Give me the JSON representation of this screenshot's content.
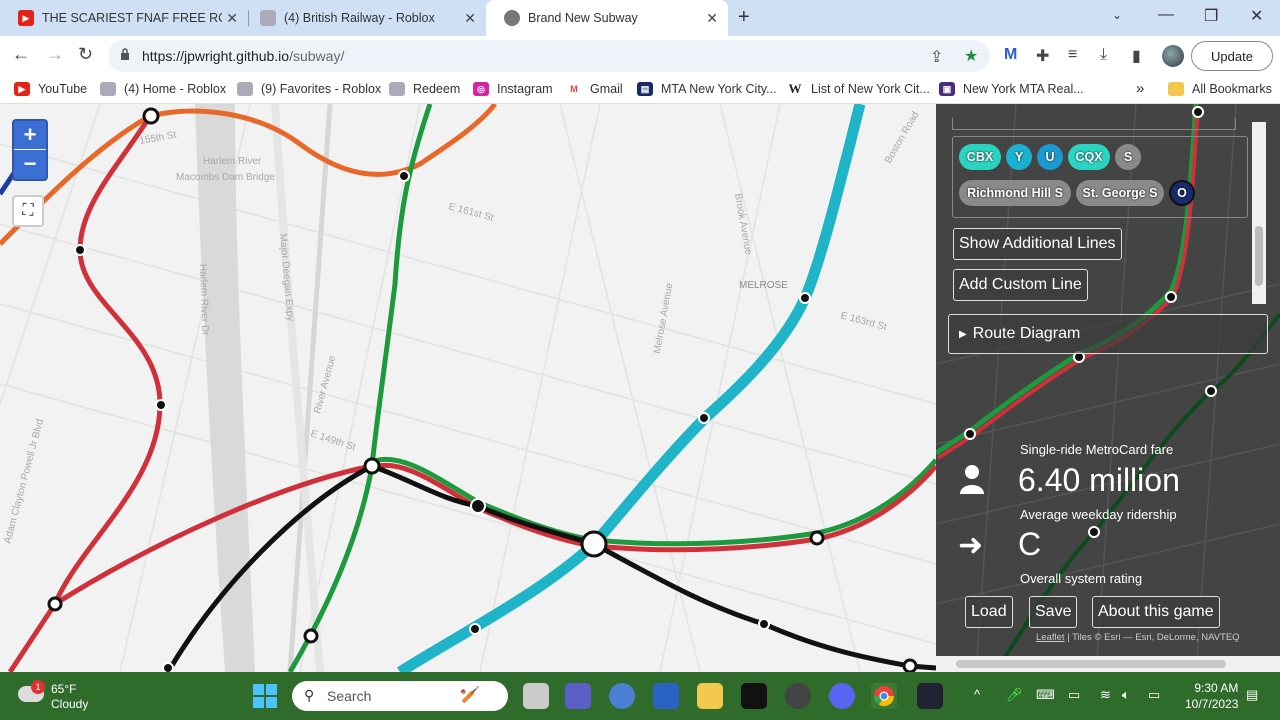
{
  "browser": {
    "tabs": [
      {
        "title": "THE SCARIEST FNAF FREE ROAM",
        "icon": "youtube-icon"
      },
      {
        "title": "(4) British Railway - Roblox",
        "icon": "roblox-icon"
      },
      {
        "title": "Brand New Subway",
        "icon": "globe-icon"
      }
    ],
    "url_host": "https://jpwright.github.io",
    "url_path": "/subway/",
    "update_label": "Update",
    "bookmarks": [
      {
        "label": "YouTube",
        "icon": "youtube-icon",
        "color": "#e62117"
      },
      {
        "label": "(4) Home - Roblox",
        "icon": "roblox-icon",
        "color": "#aab"
      },
      {
        "label": "(9) Favorites - Roblox",
        "icon": "roblox-icon",
        "color": "#aab"
      },
      {
        "label": "Redeem",
        "icon": "roblox-icon",
        "color": "#aab"
      },
      {
        "label": "Instagram",
        "icon": "instagram-icon",
        "color": "#d6249f"
      },
      {
        "label": "Gmail",
        "icon": "gmail-icon",
        "color": "#ea4335"
      },
      {
        "label": "MTA New York City...",
        "icon": "mta-icon",
        "color": "#1a2b6d"
      },
      {
        "label": "List of New York Cit...",
        "icon": "wikipedia-icon",
        "color": "#444"
      },
      {
        "label": "New York MTA Real...",
        "icon": "mta-realtime-icon",
        "color": "#4a2c7a"
      }
    ],
    "all_bookmarks_label": "All Bookmarks",
    "more_bookmarks": "»"
  },
  "map": {
    "zoom_in": "+",
    "zoom_out": "−",
    "labels": [
      {
        "text": "Harlem River"
      },
      {
        "text": "Macombs Dam Bridge"
      },
      {
        "text": "E 161st St"
      },
      {
        "text": "MELROSE"
      },
      {
        "text": "E 163rd St"
      },
      {
        "text": "Major Deegan Expy"
      },
      {
        "text": "Harlem River Dr"
      },
      {
        "text": "River Avenue"
      },
      {
        "text": "E 149th St"
      },
      {
        "text": "Melrose Avenue"
      },
      {
        "text": "Brook Avenue"
      },
      {
        "text": "Boston Road"
      },
      {
        "text": "Adam Clayton Powell Jr Blvd"
      },
      {
        "text": "155th St"
      }
    ]
  },
  "panel": {
    "chips": [
      {
        "label": "CBX",
        "color": "#2ad4c0"
      },
      {
        "label": "Y",
        "color": "#1ab0d0"
      },
      {
        "label": "U",
        "color": "#1a9ad0"
      },
      {
        "label": "CQX",
        "color": "#2ad4c0"
      },
      {
        "label": "S",
        "color": "#8a8a8a"
      },
      {
        "label": "Richmond Hill S",
        "color": "#8a8a8a"
      },
      {
        "label": "St. George S",
        "color": "#8a8a8a"
      },
      {
        "label": "O",
        "color": "#1a2b6d"
      }
    ],
    "show_additional": "Show Additional Lines",
    "add_custom": "Add Custom Line",
    "route_diagram": "Route Diagram",
    "fare_label": "Single-ride MetroCard fare",
    "ridership_value": "6.40 million",
    "ridership_label": "Average weekday ridership",
    "rating_value": "C",
    "rating_label": "Overall system rating",
    "load": "Load",
    "save": "Save",
    "about": "About this game",
    "attrib_leaflet": "Leaflet",
    "attrib_rest": " | Tiles © Esri — Esri, DeLorme, NAVTEQ"
  },
  "taskbar": {
    "temp": "65°F",
    "condition": "Cloudy",
    "weather_badge": "1",
    "search_placeholder": "Search",
    "time": "9:30 AM",
    "date": "10/7/2023"
  }
}
